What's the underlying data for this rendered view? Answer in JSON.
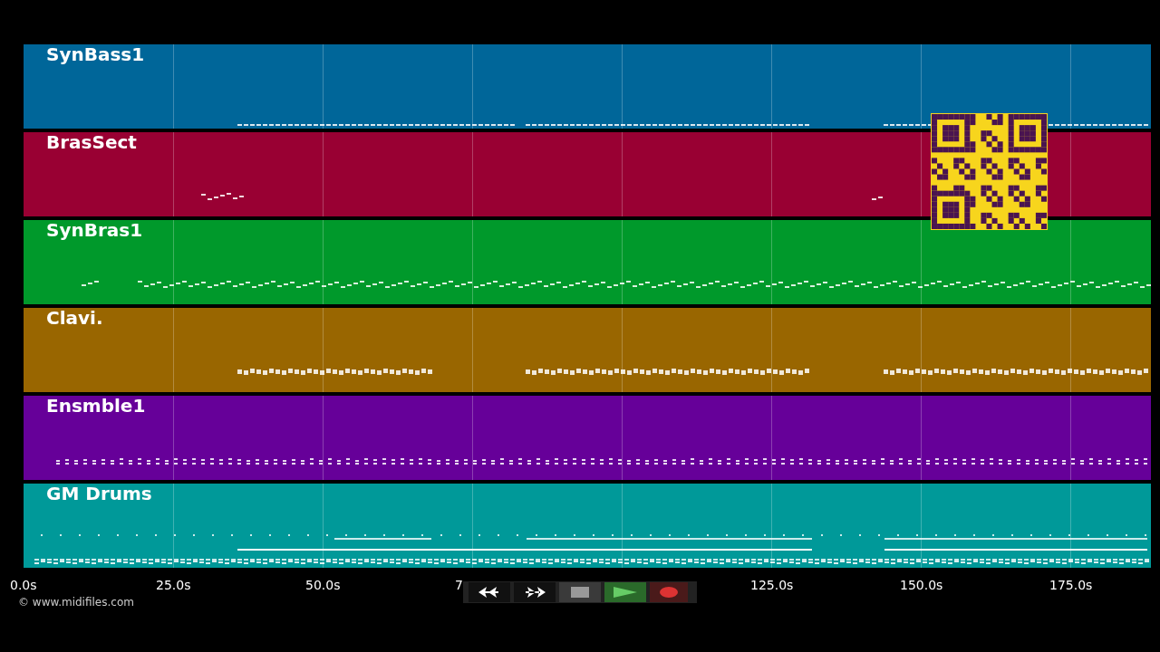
{
  "tracks": [
    {
      "name": "SynBass1",
      "color": "#006699"
    },
    {
      "name": "BrasSect",
      "color": "#990033"
    },
    {
      "name": "SynBras1",
      "color": "#00992b"
    },
    {
      "name": "Clavi.",
      "color": "#996600"
    },
    {
      "name": "Ensmble1",
      "color": "#660099"
    },
    {
      "name": "GM Drums",
      "color": "#009999"
    }
  ],
  "time_axis": [
    "0.0s",
    "25.0s",
    "50.0s",
    "7",
    "125.0s",
    "150.0s",
    "175.0s"
  ],
  "copyright": "© www.midifiles.com",
  "transport": {
    "playing": true
  }
}
